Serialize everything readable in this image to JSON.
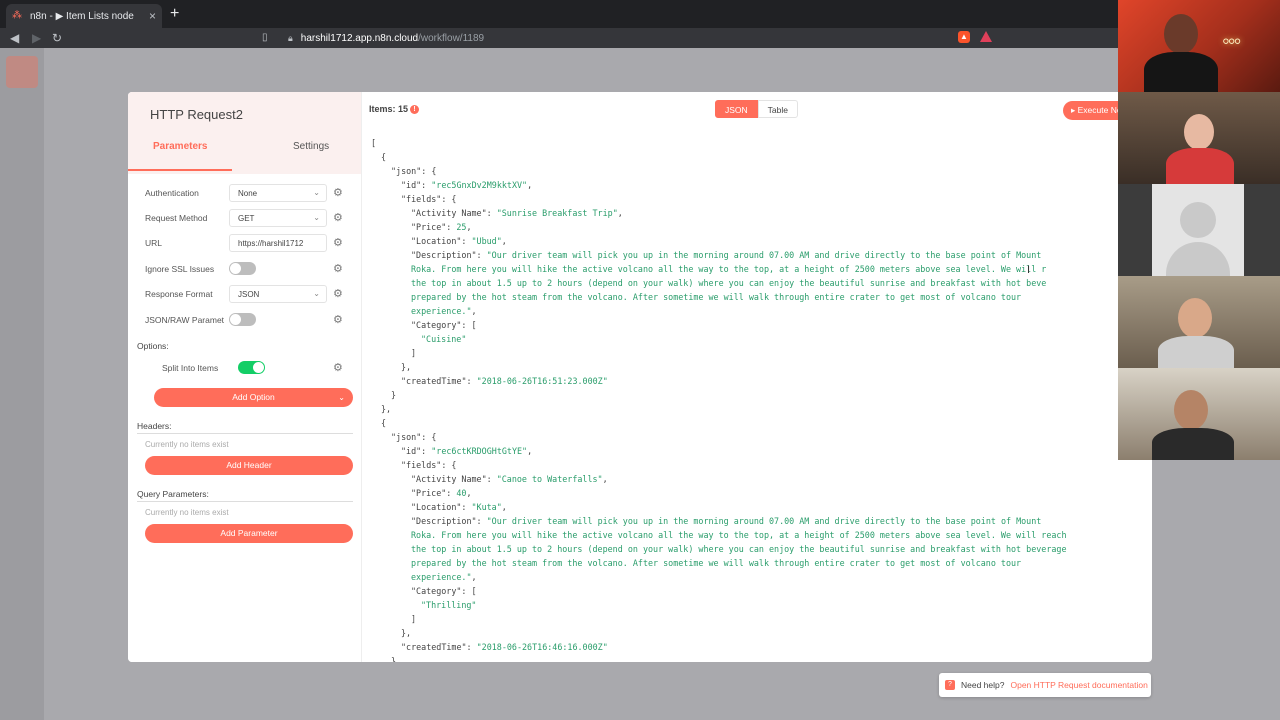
{
  "browser": {
    "tab_title": "n8n - ▶ Item Lists node",
    "url_host": "harshil1712.app.n8n.cloud",
    "url_path": "/workflow/1189",
    "new_tab": "+"
  },
  "node_panel": {
    "title": "HTTP Request2",
    "tabs": [
      "Parameters",
      "Settings"
    ],
    "params": [
      {
        "label": "Authentication",
        "value": "None",
        "type": "select"
      },
      {
        "label": "Request Method",
        "value": "GET",
        "type": "select"
      },
      {
        "label": "URL",
        "value": "https://harshil1712",
        "type": "text"
      },
      {
        "label": "Ignore SSL Issues",
        "type": "toggle",
        "on": false
      },
      {
        "label": "Response Format",
        "value": "JSON",
        "type": "select"
      },
      {
        "label": "JSON/RAW Paramet",
        "type": "toggle",
        "on": false
      }
    ],
    "options_label": "Options:",
    "split_label": "Split Into Items",
    "split_on": true,
    "add_option": "Add Option",
    "headers_label": "Headers:",
    "headers_empty": "Currently no items exist",
    "add_header": "Add Header",
    "query_label": "Query Parameters:",
    "query_empty": "Currently no items exist",
    "add_parameter": "Add Parameter"
  },
  "output": {
    "items_label": "Items: 15",
    "view_json": "JSON",
    "view_table": "Table",
    "execute_label": "Execute Node"
  },
  "json_lines": [
    {
      "indent": 0,
      "parts": [
        {
          "t": "["
        }
      ]
    },
    {
      "indent": 1,
      "parts": [
        {
          "t": "{"
        }
      ]
    },
    {
      "indent": 2,
      "parts": [
        {
          "t": "\"json\": {"
        }
      ]
    },
    {
      "indent": 3,
      "parts": [
        {
          "t": "\"id\": "
        },
        {
          "t": "\"rec5GnxDv2M9kktXV\"",
          "s": 1
        },
        {
          "t": ","
        }
      ]
    },
    {
      "indent": 3,
      "parts": [
        {
          "t": "\"fields\": {"
        }
      ]
    },
    {
      "indent": 4,
      "parts": [
        {
          "t": "\"Activity Name\": "
        },
        {
          "t": "\"Sunrise Breakfast Trip\"",
          "s": 1
        },
        {
          "t": ","
        }
      ]
    },
    {
      "indent": 4,
      "parts": [
        {
          "t": "\"Price\": "
        },
        {
          "t": "25",
          "s": 1
        },
        {
          "t": ","
        }
      ]
    },
    {
      "indent": 4,
      "parts": [
        {
          "t": "\"Location\": "
        },
        {
          "t": "\"Ubud\"",
          "s": 1
        },
        {
          "t": ","
        }
      ]
    },
    {
      "indent": 4,
      "parts": [
        {
          "t": "\"Description\": "
        },
        {
          "t": "\"Our driver team will pick you up in the morning around 07.00 AM and drive directly to the base point of Mount",
          "s": 1
        }
      ]
    },
    {
      "indent": 4,
      "parts": [
        {
          "t": "Roka. From here you will hike the active volcano all the way to the top, at a height of 2500 meters above sea level. We will r",
          "s": 1
        }
      ]
    },
    {
      "indent": 4,
      "parts": [
        {
          "t": "the top in about 1.5 up to 2 hours (depend on your walk) where you can enjoy the beautiful sunrise and breakfast with hot beve",
          "s": 1
        }
      ]
    },
    {
      "indent": 4,
      "parts": [
        {
          "t": "prepared by the hot steam from the volcano. After sometime we will walk through entire crater to get most of volcano tour",
          "s": 1
        }
      ]
    },
    {
      "indent": 4,
      "parts": [
        {
          "t": "experience.\"",
          "s": 1
        },
        {
          "t": ","
        }
      ]
    },
    {
      "indent": 4,
      "parts": [
        {
          "t": "\"Category\": ["
        }
      ]
    },
    {
      "indent": 5,
      "parts": [
        {
          "t": "\"Cuisine\"",
          "s": 1
        }
      ]
    },
    {
      "indent": 4,
      "parts": [
        {
          "t": "]"
        }
      ]
    },
    {
      "indent": 3,
      "parts": [
        {
          "t": "},"
        }
      ]
    },
    {
      "indent": 3,
      "parts": [
        {
          "t": "\"createdTime\": "
        },
        {
          "t": "\"2018-06-26T16:51:23.000Z\"",
          "s": 1
        }
      ]
    },
    {
      "indent": 2,
      "parts": [
        {
          "t": "}"
        }
      ]
    },
    {
      "indent": 1,
      "parts": [
        {
          "t": "},"
        }
      ]
    },
    {
      "indent": 1,
      "parts": [
        {
          "t": "{"
        }
      ]
    },
    {
      "indent": 2,
      "parts": [
        {
          "t": "\"json\": {"
        }
      ]
    },
    {
      "indent": 3,
      "parts": [
        {
          "t": "\"id\": "
        },
        {
          "t": "\"rec6ctKRDOGHtGtYE\"",
          "s": 1
        },
        {
          "t": ","
        }
      ]
    },
    {
      "indent": 3,
      "parts": [
        {
          "t": "\"fields\": {"
        }
      ]
    },
    {
      "indent": 4,
      "parts": [
        {
          "t": "\"Activity Name\": "
        },
        {
          "t": "\"Canoe to Waterfalls\"",
          "s": 1
        },
        {
          "t": ","
        }
      ]
    },
    {
      "indent": 4,
      "parts": [
        {
          "t": "\"Price\": "
        },
        {
          "t": "40",
          "s": 1
        },
        {
          "t": ","
        }
      ]
    },
    {
      "indent": 4,
      "parts": [
        {
          "t": "\"Location\": "
        },
        {
          "t": "\"Kuta\"",
          "s": 1
        },
        {
          "t": ","
        }
      ]
    },
    {
      "indent": 4,
      "parts": [
        {
          "t": "\"Description\": "
        },
        {
          "t": "\"Our driver team will pick you up in the morning around 07.00 AM and drive directly to the base point of Mount",
          "s": 1
        }
      ]
    },
    {
      "indent": 4,
      "parts": [
        {
          "t": "Roka. From here you will hike the active volcano all the way to the top, at a height of 2500 meters above sea level. We will reach",
          "s": 1
        }
      ]
    },
    {
      "indent": 4,
      "parts": [
        {
          "t": "the top in about 1.5 up to 2 hours (depend on your walk) where you can enjoy the beautiful sunrise and breakfast with hot beverage",
          "s": 1
        }
      ]
    },
    {
      "indent": 4,
      "parts": [
        {
          "t": "prepared by the hot steam from the volcano. After sometime we will walk through entire crater to get most of volcano tour",
          "s": 1
        }
      ]
    },
    {
      "indent": 4,
      "parts": [
        {
          "t": "experience.\"",
          "s": 1
        },
        {
          "t": ","
        }
      ]
    },
    {
      "indent": 4,
      "parts": [
        {
          "t": "\"Category\": ["
        }
      ]
    },
    {
      "indent": 5,
      "parts": [
        {
          "t": "\"Thrilling\"",
          "s": 1
        }
      ]
    },
    {
      "indent": 4,
      "parts": [
        {
          "t": "]"
        }
      ]
    },
    {
      "indent": 3,
      "parts": [
        {
          "t": "},"
        }
      ]
    },
    {
      "indent": 3,
      "parts": [
        {
          "t": "\"createdTime\": "
        },
        {
          "t": "\"2018-06-26T16:46:16.000Z\"",
          "s": 1
        }
      ]
    },
    {
      "indent": 2,
      "parts": [
        {
          "t": "}"
        }
      ]
    }
  ],
  "help": {
    "prefix": "Need help?",
    "link": "Open HTTP Request documentation"
  },
  "colors": {
    "accent": "#ff6d5a",
    "toggle_on": "#13ce66",
    "json_string": "#2a9d6b"
  }
}
